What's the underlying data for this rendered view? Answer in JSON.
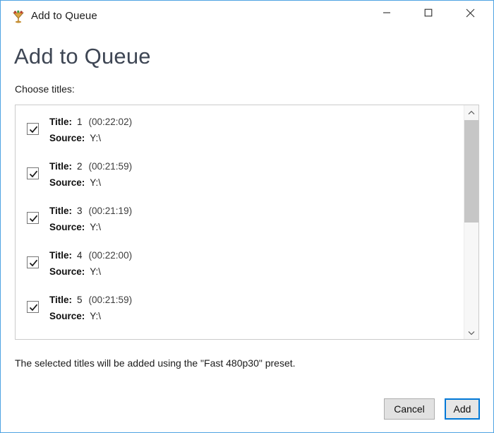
{
  "window": {
    "title": "Add to Queue",
    "icon": "handbrake-cocktail-icon",
    "accent_border": "#4fa3e3",
    "controls": {
      "minimize": "minimize-icon",
      "maximize": "maximize-icon",
      "close": "close-icon"
    }
  },
  "header": {
    "page_title": "Add to Queue",
    "page_title_color": "#3e4654",
    "choose_label": "Choose titles:"
  },
  "list": {
    "labels": {
      "title": "Title:",
      "source": "Source:"
    },
    "rows": [
      {
        "checked": true,
        "number": "1",
        "duration": "(00:22:02)",
        "source": "Y:\\"
      },
      {
        "checked": true,
        "number": "2",
        "duration": "(00:21:59)",
        "source": "Y:\\"
      },
      {
        "checked": true,
        "number": "3",
        "duration": "(00:21:19)",
        "source": "Y:\\"
      },
      {
        "checked": true,
        "number": "4",
        "duration": "(00:22:00)",
        "source": "Y:\\"
      },
      {
        "checked": true,
        "number": "5",
        "duration": "(00:21:59)",
        "source": "Y:\\"
      }
    ],
    "scrollbar": {
      "up_arrow": "chevron-up-icon",
      "down_arrow": "chevron-down-icon",
      "thumb_color": "#c6c6c6"
    }
  },
  "footer": {
    "preset_note": "The selected titles will be added using the  \"Fast 480p30\"  preset.",
    "cancel_label": "Cancel",
    "add_label": "Add",
    "default_button_accent": "#0078d7"
  }
}
